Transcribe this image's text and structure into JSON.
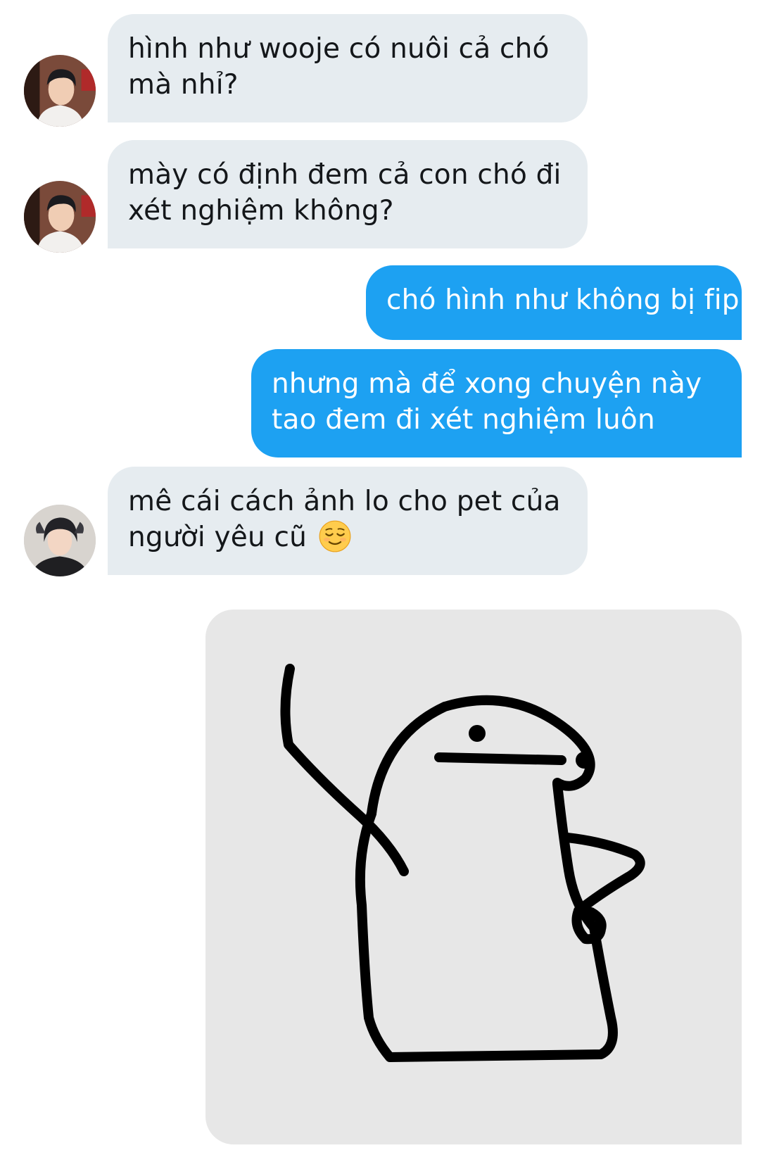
{
  "conversation": {
    "messages": [
      {
        "direction": "incoming",
        "lines": [
          "hình như wooje có nuôi cả chó",
          "mà nhỉ?"
        ]
      },
      {
        "direction": "incoming",
        "lines": [
          "mày có định đem cả con chó đi",
          "xét nghiệm không?"
        ]
      },
      {
        "direction": "outgoing",
        "lines": [
          "chó hình như không bị fip"
        ]
      },
      {
        "direction": "outgoing",
        "lines": [
          "nhưng mà để xong chuyện này",
          "tao đem đi xét nghiệm luôn"
        ]
      },
      {
        "direction": "incoming",
        "lines": [
          "mê cái cách ảnh lo cho pet của",
          "người yêu cũ"
        ],
        "emoji": "relieved-face"
      },
      {
        "direction": "outgoing",
        "media": "flork-meme-sticker"
      }
    ]
  },
  "colors": {
    "incoming_bubble": "#e6ecf0",
    "outgoing_bubble": "#1da1f2",
    "incoming_text": "#14171a",
    "outgoing_text": "#ffffff",
    "media_background": "#e7e7e7"
  }
}
